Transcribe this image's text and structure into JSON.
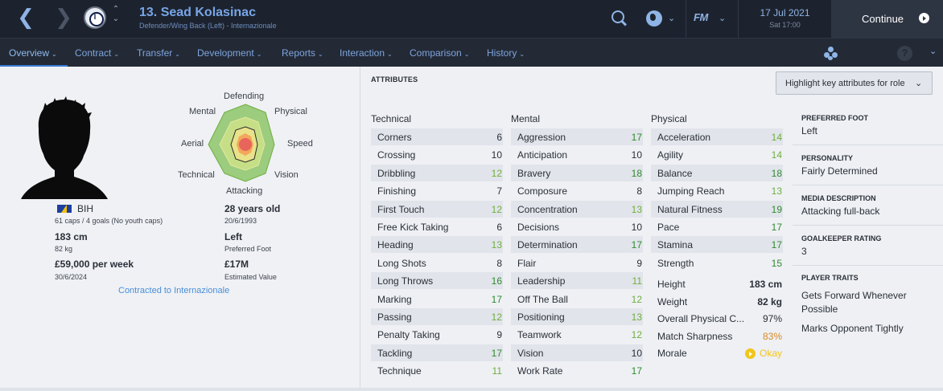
{
  "header": {
    "player_title": "13. Sead Kolasinac",
    "player_subtitle": "Defender/Wing Back (Left) - Internazionale",
    "club_crest": "inter-crest-icon",
    "fm_logo": "FM",
    "date": "17 Jul 2021",
    "time": "Sat 17:00",
    "continue_label": "Continue"
  },
  "tabs": [
    {
      "label": "Overview"
    },
    {
      "label": "Contract"
    },
    {
      "label": "Transfer"
    },
    {
      "label": "Development"
    },
    {
      "label": "Reports"
    },
    {
      "label": "Interaction"
    },
    {
      "label": "Comparison"
    },
    {
      "label": "History"
    }
  ],
  "help_label": "?",
  "radar": {
    "labels": [
      "Defending",
      "Physical",
      "Speed",
      "Vision",
      "Attacking",
      "Technical",
      "Aerial",
      "Mental"
    ],
    "colors": {
      "outer": "#9ccc7e",
      "mid": "#e9e28a",
      "inner": "#f2a85b",
      "core": "#e8655b"
    }
  },
  "bio": {
    "nationality": "BIH",
    "caps": "61 caps / 4 goals (No youth caps)",
    "age": "28 years old",
    "dob": "20/6/1993",
    "height": "183 cm",
    "weight": "82 kg",
    "preferred_foot": "Left",
    "preferred_foot_label": "Preferred Foot",
    "wage": "£59,000 per week",
    "contract_expiry": "30/6/2024",
    "value": "£17M",
    "value_label": "Estimated Value",
    "contract_link": "Contracted to Internazionale"
  },
  "attributes": {
    "heading": "ATTRIBUTES",
    "highlight_button": "Highlight key attributes for role",
    "columns": [
      "Technical",
      "Mental",
      "Physical"
    ],
    "technical": [
      {
        "name": "Corners",
        "value": "6"
      },
      {
        "name": "Crossing",
        "value": "10"
      },
      {
        "name": "Dribbling",
        "value": "12"
      },
      {
        "name": "Finishing",
        "value": "7"
      },
      {
        "name": "First Touch",
        "value": "12"
      },
      {
        "name": "Free Kick Taking",
        "value": "6"
      },
      {
        "name": "Heading",
        "value": "13"
      },
      {
        "name": "Long Shots",
        "value": "8"
      },
      {
        "name": "Long Throws",
        "value": "16"
      },
      {
        "name": "Marking",
        "value": "17"
      },
      {
        "name": "Passing",
        "value": "12"
      },
      {
        "name": "Penalty Taking",
        "value": "9"
      },
      {
        "name": "Tackling",
        "value": "17"
      },
      {
        "name": "Technique",
        "value": "11"
      }
    ],
    "mental": [
      {
        "name": "Aggression",
        "value": "17"
      },
      {
        "name": "Anticipation",
        "value": "10"
      },
      {
        "name": "Bravery",
        "value": "18"
      },
      {
        "name": "Composure",
        "value": "8"
      },
      {
        "name": "Concentration",
        "value": "13"
      },
      {
        "name": "Decisions",
        "value": "10"
      },
      {
        "name": "Determination",
        "value": "17"
      },
      {
        "name": "Flair",
        "value": "9"
      },
      {
        "name": "Leadership",
        "value": "11"
      },
      {
        "name": "Off The Ball",
        "value": "12"
      },
      {
        "name": "Positioning",
        "value": "13"
      },
      {
        "name": "Teamwork",
        "value": "12"
      },
      {
        "name": "Vision",
        "value": "10"
      },
      {
        "name": "Work Rate",
        "value": "17"
      }
    ],
    "physical": [
      {
        "name": "Acceleration",
        "value": "14"
      },
      {
        "name": "Agility",
        "value": "14"
      },
      {
        "name": "Balance",
        "value": "18"
      },
      {
        "name": "Jumping Reach",
        "value": "13"
      },
      {
        "name": "Natural Fitness",
        "value": "19"
      },
      {
        "name": "Pace",
        "value": "17"
      },
      {
        "name": "Stamina",
        "value": "17"
      },
      {
        "name": "Strength",
        "value": "15"
      }
    ],
    "physical_extra": [
      {
        "name": "Height",
        "value": "183 cm"
      },
      {
        "name": "Weight",
        "value": "82 kg"
      },
      {
        "name": "Overall Physical C...",
        "value": "97%"
      },
      {
        "name": "Match Sharpness",
        "value": "83%"
      },
      {
        "name": "Morale",
        "value": "Okay"
      }
    ]
  },
  "info": {
    "preferred_foot_label": "PREFERRED FOOT",
    "preferred_foot": "Left",
    "personality_label": "PERSONALITY",
    "personality": "Fairly Determined",
    "media_label": "MEDIA DESCRIPTION",
    "media": "Attacking full-back",
    "gk_label": "GOALKEEPER RATING",
    "gk": "3",
    "traits_label": "PLAYER TRAITS",
    "trait_1_line1": "Gets Forward Whenever",
    "trait_1_line2": "Possible",
    "trait_2": "Marks Opponent Tightly"
  },
  "value_colors": {
    "low": "#2a2f38",
    "mid": "#6fae3e",
    "high": "#2f8a2f",
    "sharpness": "#d88a22",
    "morale": "#f2c51b"
  }
}
